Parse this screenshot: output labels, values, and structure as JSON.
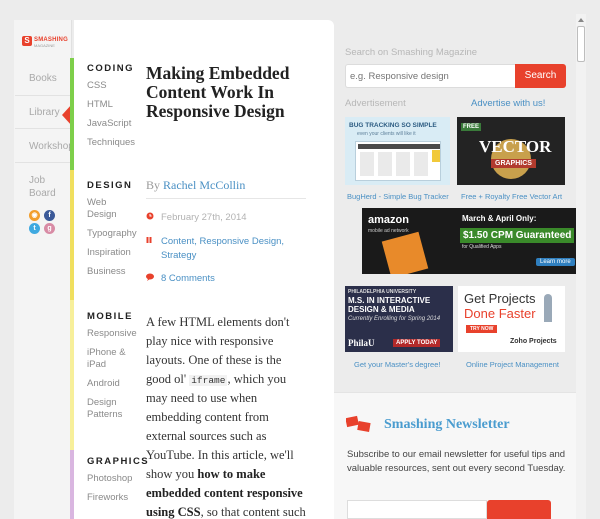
{
  "brand": {
    "word": "SMASHING",
    "sub": "MAGAZINE"
  },
  "leftnav": {
    "items": [
      "Books",
      "Library",
      "Workshops",
      "Job Board"
    ]
  },
  "categories": [
    {
      "title": "CODING",
      "items": [
        "CSS",
        "HTML",
        "JavaScript",
        "Techniques"
      ]
    },
    {
      "title": "DESIGN",
      "items": [
        "Web Design",
        "Typography",
        "Inspiration",
        "Business"
      ]
    },
    {
      "title": "MOBILE",
      "items": [
        "Responsive",
        "iPhone & iPad",
        "Android",
        "Design Patterns"
      ]
    },
    {
      "title": "GRAPHICS",
      "items": [
        "Photoshop",
        "Fireworks"
      ]
    }
  ],
  "article": {
    "title": "Making Embedded Content Work In Responsive Design",
    "by": "By",
    "author": "Rachel McCollin",
    "date": "February 27th, 2014",
    "tags": "Content, Responsive Design, Strategy",
    "comments": "8 Comments",
    "body_1": "A few HTML elements don't play nice with responsive layouts. One of these is the good ol'",
    "body_code": "iframe",
    "body_2": ", which you may need to use when embedding content from external sources such as YouTube. In this article, we'll show you",
    "body_bold": "how to make embedded content responsive using CSS",
    "body_3": ", so that content such as video"
  },
  "sidebar": {
    "search_label": "Search on Smashing Magazine",
    "search_placeholder": "e.g. Responsive design",
    "search_button": "Search",
    "advertisement_label": "Advertisement",
    "advertise_link": "Advertise with us!",
    "ads": [
      {
        "caption": "BugHerd - Simple Bug Tracker",
        "headline": "BUG TRACKING SO SIMPLE",
        "sub": "even your clients will like it"
      },
      {
        "caption": "Free + Royalty Free Vector Art",
        "headline": "VECTOR",
        "sub": "GRAPHICS",
        "badge": "FREE"
      },
      {
        "brand": "amazon",
        "brand_sub": "mobile ad network",
        "line1": "March & April Only:",
        "line2": "$1.50 CPM Guaranteed",
        "line3": "for Qualified Apps",
        "cta": "Learn more"
      },
      {
        "caption": "Get your Master's degree!",
        "top": "PHILADELPHIA UNIVERSITY",
        "headline": "M.S. IN INTERACTIVE DESIGN & MEDIA",
        "line": "Currently Enrolling for Spring 2014",
        "logo": "PhilaU",
        "cta": "APPLY TODAY"
      },
      {
        "caption": "Online Project Management",
        "line1": "Get Projects",
        "line2": "Done Faster",
        "cta": "TRY NOW",
        "logo": "Zoho Projects"
      }
    ]
  },
  "newsletter": {
    "title": "Smashing Newsletter",
    "text": "Subscribe to our email newsletter for useful tips and valuable resources, sent out every second Tuesday."
  },
  "colors": {
    "accent": "#e8412c",
    "link": "#4a90c4",
    "coding": "#7ecf4a",
    "design": "#f0df5e",
    "mobile": "#f7ef9a",
    "graphics": "#d9b6e0"
  }
}
